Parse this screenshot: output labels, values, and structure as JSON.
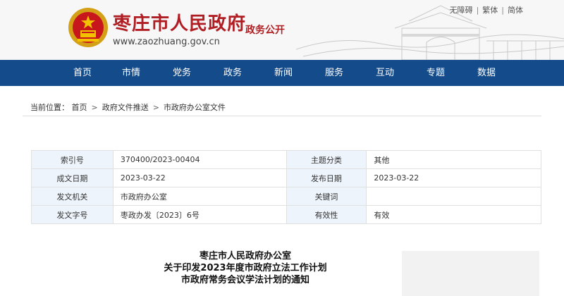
{
  "header": {
    "site_title": "枣庄市人民政府",
    "site_subtitle": "政务公开",
    "site_url": "www.zaozhuang.gov.cn",
    "top_links": [
      "无障碍",
      "繁体",
      "简体"
    ],
    "brand_color": "#b01e23",
    "emblem_icon": "national-emblem-icon",
    "skyline_graphic": "city-gate-skyline"
  },
  "nav": {
    "background": "#144b8b",
    "items": [
      "首页",
      "市情",
      "党务",
      "政务",
      "新闻",
      "服务",
      "互动",
      "专题",
      "数据"
    ]
  },
  "breadcrumb": {
    "label": "当前位置：",
    "items": [
      "首页",
      "政府文件推送",
      "市政府办公室文件"
    ],
    "separator": ">"
  },
  "info_table": {
    "rows": [
      {
        "label1": "索引号",
        "value1": "370400/2023-00404",
        "label2": "主题分类",
        "value2": "其他"
      },
      {
        "label1": "成文日期",
        "value1": "2023-03-22",
        "label2": "发布日期",
        "value2": "2023-03-22"
      },
      {
        "label1": "发文机关",
        "value1": "市政府办公室",
        "label2": "关键词",
        "value2": ""
      },
      {
        "label1": "发文字号",
        "value1": "枣政办发〔2023〕6号",
        "label2": "有效性",
        "value2": "有效"
      }
    ]
  },
  "article": {
    "title_lines": [
      "枣庄市人民政府办公室",
      "关于印发2023年度市政府立法工作计划",
      "市政府常务会议学法计划的通知"
    ]
  }
}
